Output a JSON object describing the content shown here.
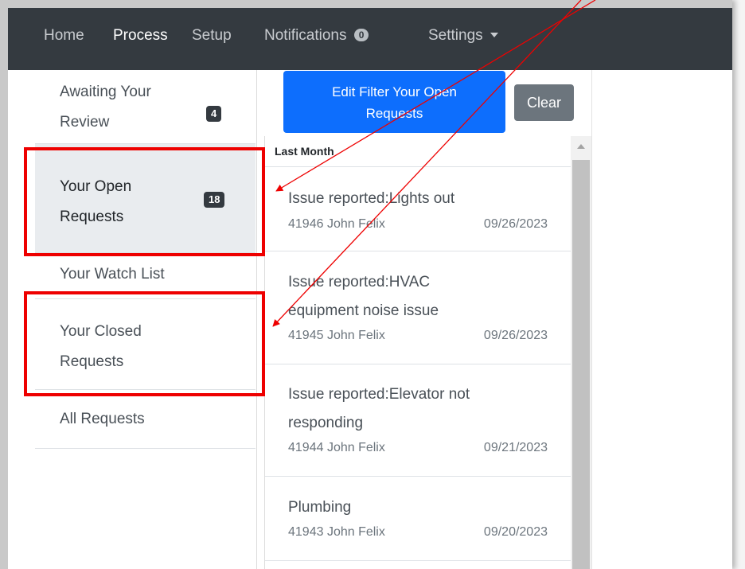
{
  "navbar": {
    "items": [
      {
        "label": "Home"
      },
      {
        "label": "Process"
      },
      {
        "label": "Setup"
      },
      {
        "label": "Notifications",
        "badge": "0"
      },
      {
        "label": "Settings"
      }
    ]
  },
  "sidebar": {
    "items": [
      {
        "label_line1": "Awaiting Your",
        "label_line2": "Review",
        "count": "4"
      },
      {
        "label_line1": "Your Open",
        "label_line2": "Requests",
        "count": "18"
      },
      {
        "label_line1": "Your Watch List"
      },
      {
        "label_line1": "Your Closed",
        "label_line2": "Requests"
      },
      {
        "label_line1": "All Requests"
      }
    ]
  },
  "toolbar": {
    "filter_line1": "Edit Filter Your Open",
    "filter_line2": "Requests",
    "clear": "Clear"
  },
  "requests": {
    "section": "Last Month",
    "items": [
      {
        "title1": "Issue reported:Lights out",
        "id_user": "41946 John Felix",
        "date": "09/26/2023"
      },
      {
        "title1": "Issue reported:HVAC",
        "title2": "equipment noise issue",
        "id_user": "41945 John Felix",
        "date": "09/26/2023"
      },
      {
        "title1": "Issue reported:Elevator not",
        "title2": "responding",
        "id_user": "41944 John Felix",
        "date": "09/21/2023"
      },
      {
        "title1": "Plumbing",
        "id_user": "41943 John Felix",
        "date": "09/20/2023"
      }
    ]
  },
  "colors": {
    "navbar": "#343a40",
    "primary": "#0d6efd",
    "secondary": "#6c757d",
    "annotation": "#ee0000"
  }
}
